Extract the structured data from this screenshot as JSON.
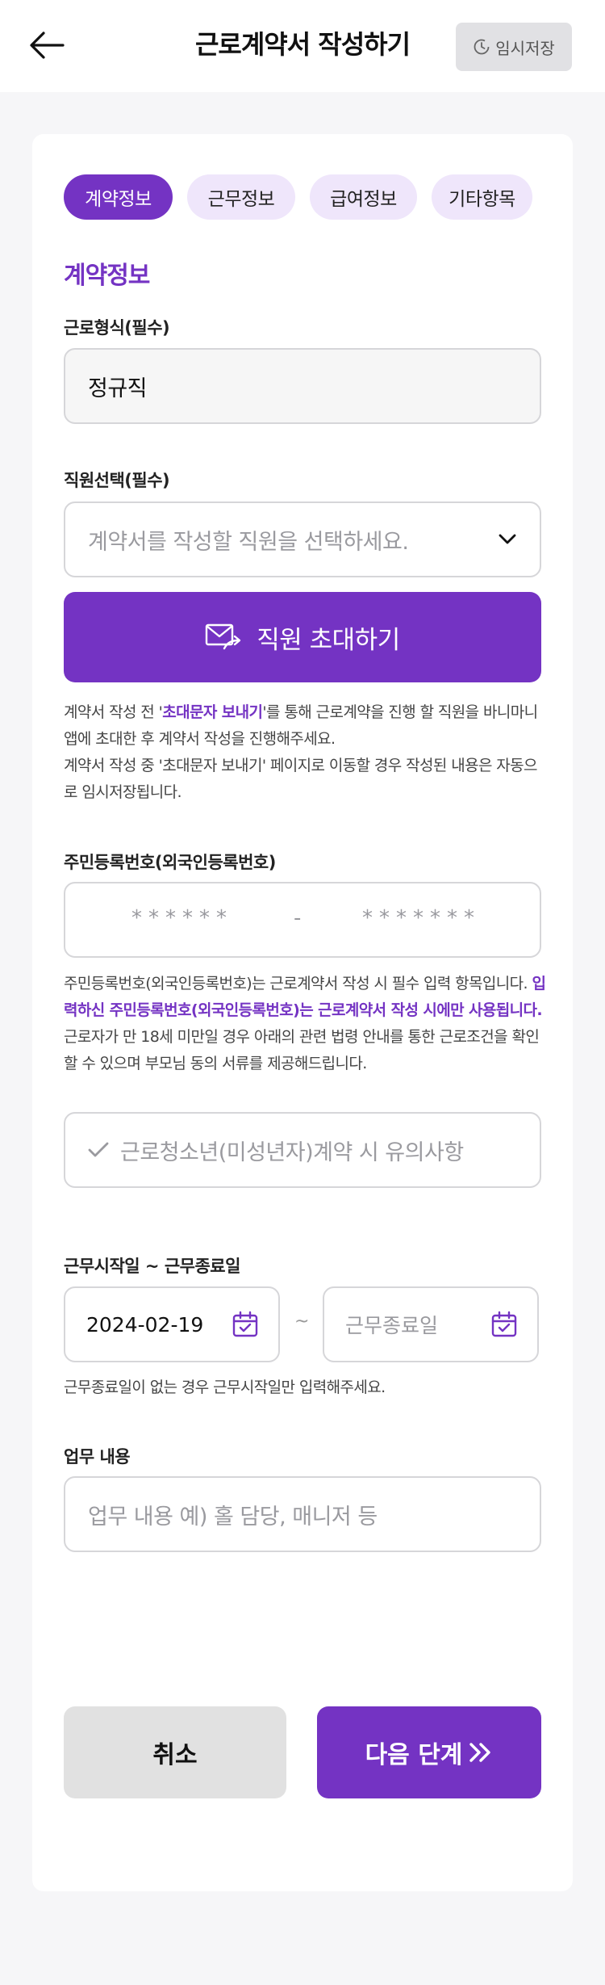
{
  "header": {
    "title": "근로계약서 작성하기",
    "draft_label": "임시저장"
  },
  "tabs": [
    {
      "label": "계약정보",
      "active": true
    },
    {
      "label": "근무정보",
      "active": false
    },
    {
      "label": "급여정보",
      "active": false
    },
    {
      "label": "기타항목",
      "active": false
    }
  ],
  "section_title": "계약정보",
  "work_type": {
    "label": "근로형식(필수)",
    "value": "정규직"
  },
  "employee": {
    "label": "직원선택(필수)",
    "placeholder": "계약서를 작성할 직원을 선택하세요."
  },
  "invite": {
    "button_label": "직원 초대하기",
    "note_1a": "계약서 작성 전 '",
    "note_1b": "초대문자 보내기",
    "note_1c": "'를 통해 근로계약을 진행 할 직원을 바니마니 앱에 초대한 후 계약서 작성을 진행해주세요.",
    "note_2": "계약서 작성 중 '초대문자 보내기' 페이지로 이동할 경우 작성된 내용은 자동으로 임시저장됩니다."
  },
  "resident": {
    "label": "주민등록번호(외국인등록번호)",
    "mask_front": "******",
    "separator": "-",
    "mask_back": "*******",
    "note_1": "주민등록번호(외국인등록번호)는 근로계약서 작성 시 필수 입력 항목입니다. ",
    "note_1_hl": "입력하신 주민등록번호(외국인등록번호)는 근로계약서 작성 시에만 사용됩니다.",
    "note_2": "근로자가 만 18세 미만일 경우 아래의 관련 법령 안내를 통한 근로조건을 확인할 수 있으며 부모님 동의 서류를 제공해드립니다.",
    "minor_notice": "근로청소년(미성년자)계약 시 유의사항"
  },
  "period": {
    "label": "근무시작일 ~ 근무종료일",
    "start_value": "2024-02-19",
    "tilde": "~",
    "end_placeholder": "근무종료일",
    "note": "근무종료일이 없는 경우 근무시작일만 입력해주세요."
  },
  "duty": {
    "label": "업무 내용",
    "placeholder": "업무 내용 예) 홀 담당, 매니저 등"
  },
  "actions": {
    "cancel": "취소",
    "next": "다음 단계"
  },
  "colors": {
    "accent": "#7433c3",
    "tab_inactive_bg": "#efe6fb",
    "background": "#f6f6f8"
  }
}
